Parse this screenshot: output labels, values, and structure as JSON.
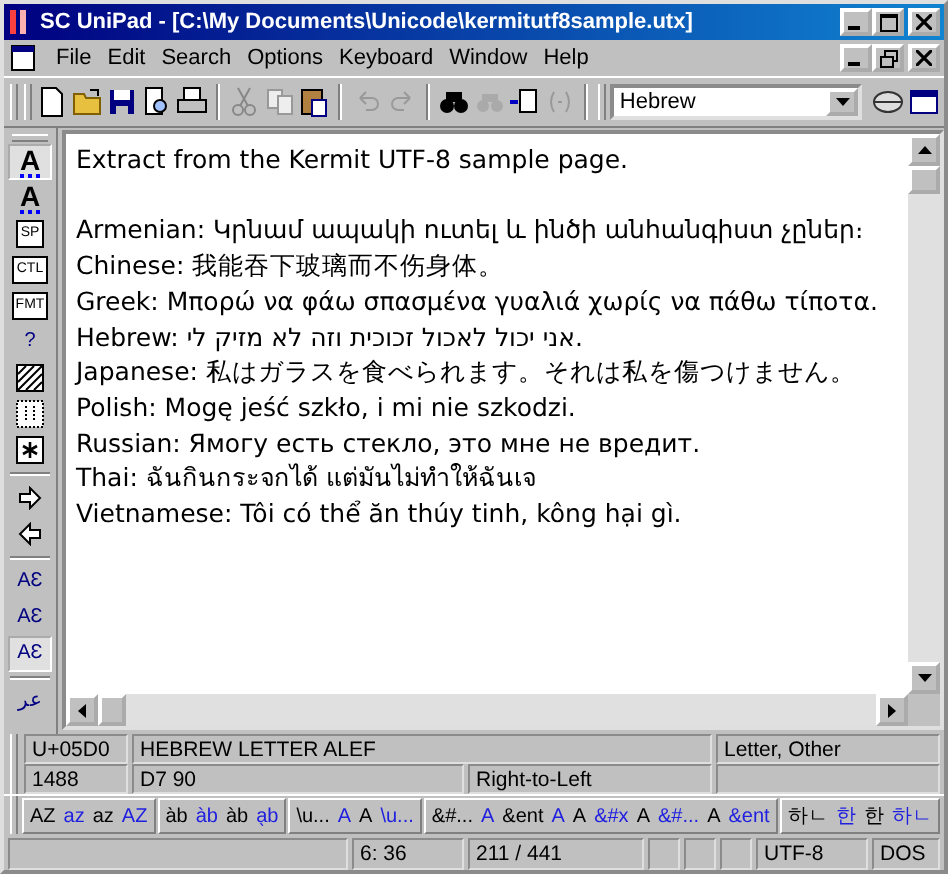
{
  "window": {
    "title": "SC UniPad - [C:\\My Documents\\Unicode\\kermitutf8sample.utx]"
  },
  "menu": [
    "File",
    "Edit",
    "Search",
    "Options",
    "Keyboard",
    "Window",
    "Help"
  ],
  "script_select": {
    "value": "Hebrew"
  },
  "left_tools": [
    {
      "kind": "text",
      "label": "A",
      "selected": true
    },
    {
      "kind": "text",
      "label": "A",
      "selected": false
    },
    {
      "kind": "text",
      "label": "SP",
      "selected": false
    },
    {
      "kind": "text",
      "label": "CTL",
      "selected": false
    },
    {
      "kind": "text",
      "label": "FMT",
      "selected": false
    },
    {
      "kind": "text",
      "label": "?",
      "selected": false
    },
    {
      "kind": "hatch",
      "selected": false
    },
    {
      "kind": "dotgrid",
      "selected": false
    },
    {
      "kind": "asterisk",
      "selected": false
    },
    {
      "kind": "forward",
      "selected": false
    },
    {
      "kind": "back",
      "selected": false
    },
    {
      "kind": "text",
      "label": "AƐ",
      "selected": false
    },
    {
      "kind": "text",
      "label": "AƐ",
      "selected": false
    },
    {
      "kind": "text",
      "label": "AƐ",
      "selected": true
    },
    {
      "kind": "text",
      "label": "عر",
      "selected": false
    }
  ],
  "editor": {
    "heading": "Extract from the Kermit UTF-8 sample page.",
    "lines": [
      "Armenian: Կրնամ ապակի ուտել և ինծի անհանգիստ չըներ։",
      "Chinese: 我能吞下玻璃而不伤身体。",
      "Greek: Μπορώ να φάω σπασμένα γυαλιά χωρίς να πάθω τίποτα.",
      "Hebrew: אני יכול לאכול זכוכית וזה לא מזיק לי.",
      "Japanese: 私はガラスを食べられます。それは私を傷つけません。",
      "Polish: Mogę jeść szkło, i mi nie szkodzi.",
      "Russian: Ямогу есть стекло, это мне не вредит.",
      "Thai: ฉันกินกระจกได้ แต่มันไม่ทำให้ฉันเจ",
      "Vietnamese: Tôi có thể ăn thúy tinh, kông hại gì."
    ]
  },
  "char_info": [
    "U+05D0",
    "HEBREW LETTER ALEF",
    "Letter, Other"
  ],
  "char_info_2": [
    "1488",
    "D7 90",
    "Right-to-Left"
  ],
  "conversion_bar": [
    [
      {
        "text": "AZ",
        "color": "#000000"
      },
      {
        "text": "az",
        "color": "#2020e0"
      },
      {
        "text": "az",
        "color": "#000000"
      },
      {
        "text": "AZ",
        "color": "#2020e0"
      }
    ],
    [
      {
        "text": "a͏̀b",
        "color": "#000000"
      },
      {
        "text": "àb",
        "color": "#2020e0"
      },
      {
        "text": "àb",
        "color": "#000000"
      },
      {
        "text": "a̖b",
        "color": "#2020e0"
      }
    ],
    [
      {
        "text": "\\u...",
        "color": "#000000"
      },
      {
        "text": "A",
        "color": "#2020e0"
      },
      {
        "text": "A",
        "color": "#000000"
      },
      {
        "text": "\\u...",
        "color": "#2020e0"
      }
    ],
    [
      {
        "text": "&#...",
        "color": "#000000"
      },
      {
        "text": "A",
        "color": "#2020e0"
      },
      {
        "text": "&ent",
        "color": "#000000"
      },
      {
        "text": "A",
        "color": "#2020e0"
      },
      {
        "text": "A",
        "color": "#000000"
      },
      {
        "text": "&#x",
        "color": "#2020e0"
      },
      {
        "text": "A",
        "color": "#000000"
      },
      {
        "text": "&#...",
        "color": "#2020e0"
      },
      {
        "text": "A",
        "color": "#000000"
      },
      {
        "text": "&ent",
        "color": "#2020e0"
      }
    ],
    [
      {
        "text": "하ㄴ",
        "color": "#000000"
      },
      {
        "text": "한",
        "color": "#2020e0"
      },
      {
        "text": "한",
        "color": "#000000"
      },
      {
        "text": "하ㄴ",
        "color": "#2020e0"
      }
    ]
  ],
  "status_bar": {
    "position": "6: 36",
    "count": "211 / 441",
    "encoding": "UTF-8",
    "line_ending": "DOS"
  }
}
